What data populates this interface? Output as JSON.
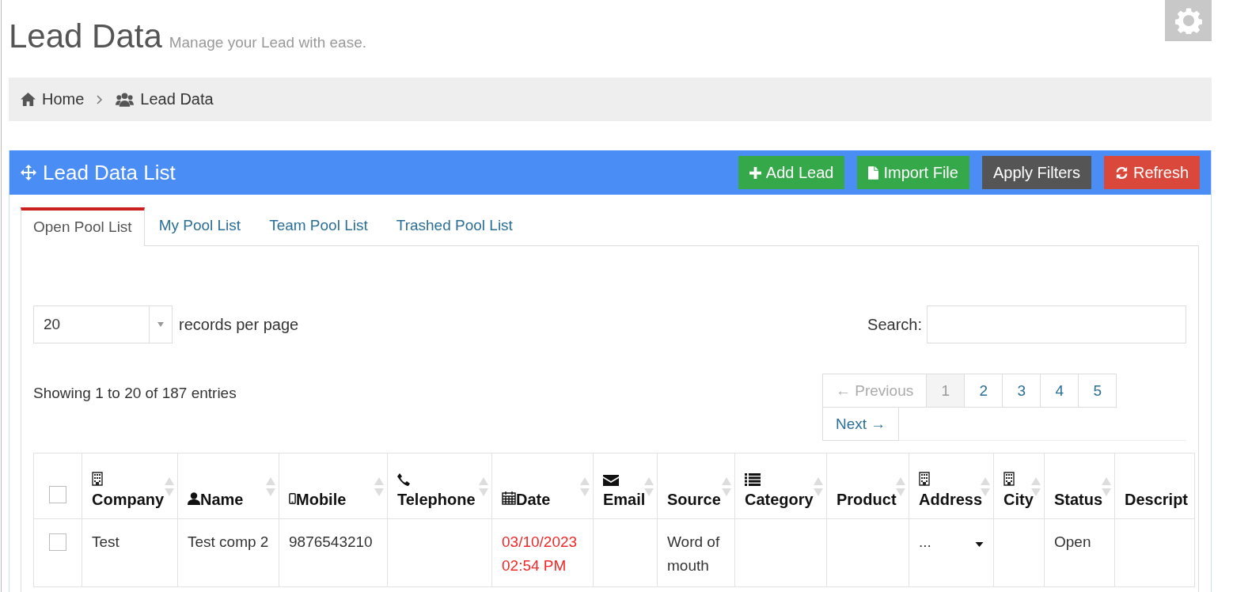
{
  "page": {
    "title": "Lead Data",
    "subtitle": "Manage your Lead with ease."
  },
  "breadcrumb": [
    {
      "label": "Home"
    },
    {
      "label": "Lead Data"
    }
  ],
  "panel": {
    "title": "Lead Data List",
    "actions": [
      {
        "label": "Add Lead",
        "kind": "success"
      },
      {
        "label": "Import File",
        "kind": "success"
      },
      {
        "label": "Apply Filters",
        "kind": "dark"
      },
      {
        "label": "Refresh",
        "kind": "danger"
      }
    ]
  },
  "tabs": [
    {
      "label": "Open Pool List",
      "selected": true
    },
    {
      "label": "My Pool List",
      "selected": false
    },
    {
      "label": "Team Pool List",
      "selected": false
    },
    {
      "label": "Trashed Pool List",
      "selected": false
    }
  ],
  "length_select": {
    "value": "20",
    "label": "records per page"
  },
  "search": {
    "label": "Search:"
  },
  "info": "Showing 1 to 20 of 187 entries",
  "pagination": [
    {
      "label": "← Previous",
      "disabled": true,
      "selected": false
    },
    {
      "label": "1",
      "disabled": false,
      "selected": true
    },
    {
      "label": "2",
      "disabled": false,
      "selected": false
    },
    {
      "label": "3",
      "disabled": false,
      "selected": false
    },
    {
      "label": "4",
      "disabled": false,
      "selected": false
    },
    {
      "label": "5",
      "disabled": false,
      "selected": false
    },
    {
      "label": "Next →",
      "disabled": false,
      "selected": false
    }
  ],
  "table": {
    "all_checked": false,
    "columns": [
      {
        "label": "Company",
        "sortable": true
      },
      {
        "label": "Name",
        "sortable": true
      },
      {
        "label": "Mobile",
        "sortable": true
      },
      {
        "label": "Telephone",
        "sortable": true
      },
      {
        "label": "Date",
        "sortable": true
      },
      {
        "label": "Email",
        "sortable": true
      },
      {
        "label": "Source",
        "sortable": true
      },
      {
        "label": "Category",
        "sortable": true
      },
      {
        "label": "Product",
        "sortable": true
      },
      {
        "label": "Address",
        "sortable": true
      },
      {
        "label": "City",
        "sortable": true
      },
      {
        "label": "Status",
        "sortable": true
      },
      {
        "label": "Descript",
        "sortable": false
      }
    ],
    "rows": [
      {
        "checked": false,
        "cells": [
          {
            "kind": "text",
            "text": "Test"
          },
          {
            "kind": "text",
            "text": "Test comp 2"
          },
          {
            "kind": "text",
            "text": "9876543210"
          },
          {
            "kind": "empty"
          },
          {
            "kind": "alert",
            "text": "03/10/2023 02:54 PM"
          },
          {
            "kind": "empty"
          },
          {
            "kind": "text",
            "text": "Word of mouth"
          },
          {
            "kind": "empty"
          },
          {
            "kind": "empty"
          },
          {
            "kind": "dropdown",
            "text": "..."
          },
          {
            "kind": "empty"
          },
          {
            "kind": "text",
            "text": "Open"
          },
          {
            "kind": "empty"
          }
        ]
      }
    ]
  }
}
